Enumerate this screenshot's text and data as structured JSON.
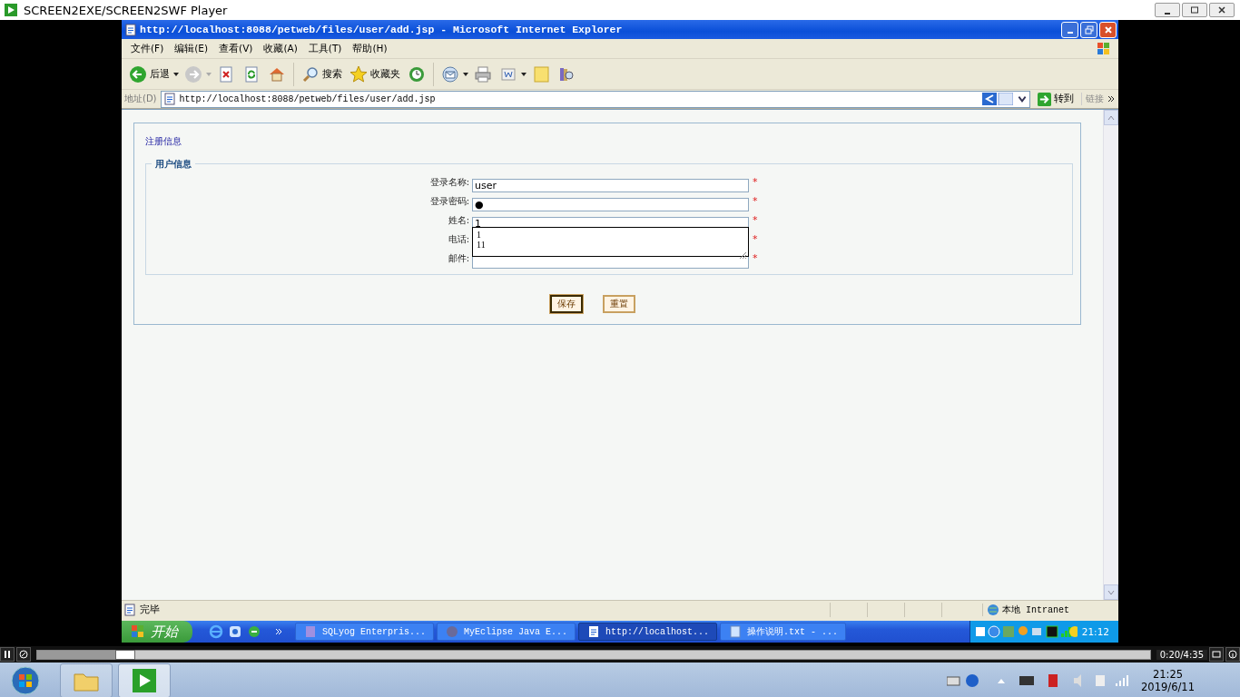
{
  "player": {
    "title": "SCREEN2EXE/SCREEN2SWF Player",
    "seek": {
      "level": 0.073
    },
    "time": "0:20/4:35"
  },
  "ie": {
    "title": "http://localhost:8088/petweb/files/user/add.jsp - Microsoft Internet Explorer",
    "menu": [
      "文件(F)",
      "编辑(E)",
      "查看(V)",
      "收藏(A)",
      "工具(T)",
      "帮助(H)"
    ],
    "toolbar": [
      {
        "kind": "back",
        "label": "后退",
        "caret": true
      },
      {
        "kind": "forward",
        "caret": true
      },
      {
        "kind": "stop"
      },
      {
        "kind": "refresh"
      },
      {
        "kind": "home"
      },
      {
        "kind": "sep"
      },
      {
        "kind": "search",
        "label": "搜索"
      },
      {
        "kind": "star",
        "label": "收藏夹"
      },
      {
        "kind": "history"
      },
      {
        "kind": "sep"
      },
      {
        "kind": "mail",
        "caret": true
      },
      {
        "kind": "print"
      },
      {
        "kind": "word",
        "caret": true
      },
      {
        "kind": "note"
      },
      {
        "kind": "research"
      }
    ],
    "address": {
      "label": "地址(D)",
      "url": "http://localhost:8088/petweb/files/user/add.jsp",
      "go": "转到",
      "links": "链接"
    },
    "page": {
      "heading": "注册信息",
      "legend": "用户信息",
      "fields": [
        {
          "label": "登录名称:",
          "value": "user",
          "marker": "*"
        },
        {
          "label": "登录密码:",
          "value": "●",
          "marker": "*"
        },
        {
          "label": "姓名:",
          "value": "1",
          "marker": "*"
        },
        {
          "label": "电话:",
          "marker": "*"
        },
        {
          "label": "邮件:",
          "marker": "*"
        }
      ],
      "autocomplete": [
        "1",
        "11"
      ],
      "buttons": [
        {
          "label": "保存",
          "focused": true
        },
        {
          "label": "重置",
          "focused": false
        }
      ]
    },
    "status": {
      "text": "完毕",
      "zone": "本地 Intranet"
    },
    "taskbar": {
      "start": "开始",
      "tasks": [
        {
          "label": "SQLyog Enterpris...",
          "kind": "db",
          "selected": false
        },
        {
          "label": "MyEclipse Java E...",
          "kind": "eclipse",
          "selected": false
        },
        {
          "label": "http://localhost...",
          "kind": "ie",
          "selected": true
        },
        {
          "label": "操作说明.txt - ...",
          "kind": "txt",
          "selected": false
        }
      ],
      "clock": "21:12"
    }
  },
  "win7": {
    "time": "21:25",
    "date": "2019/6/11"
  }
}
